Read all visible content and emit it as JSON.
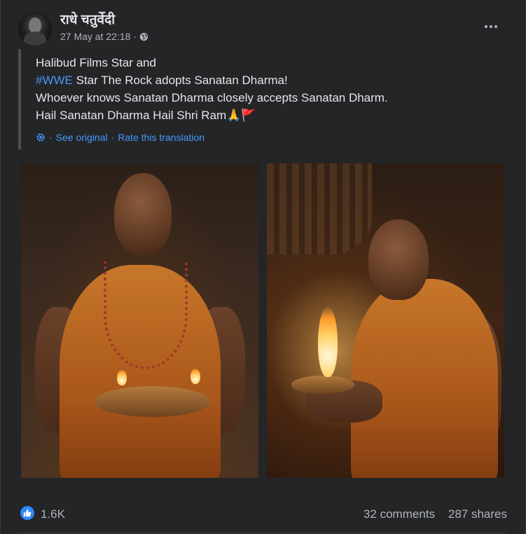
{
  "post": {
    "author": "राधे चतुर्वेदी",
    "timestamp": "27 May at 22:18",
    "separator": "·",
    "audience_icon": "globe-icon",
    "more_icon": "more-options-icon",
    "text_lines": [
      {
        "text": "Halibud Films Star and"
      },
      {
        "hashtag": "#WWE",
        "text": " Star The Rock adopts Sanatan Dharma!"
      },
      {
        "text": "Whoever knows Sanatan Dharma closely accepts Sanatan Dharm."
      },
      {
        "text": "Hail Sanatan Dharma Hail Shri Ram🙏🚩"
      }
    ],
    "translation": {
      "icon": "gear-icon",
      "see_original": "See original",
      "dot": "·",
      "rate": "Rate this translation"
    },
    "photos": [
      {
        "subject": "man in saffron robe holding tray of lit diyas"
      },
      {
        "subject": "man in saffron robe holding a single lit diya"
      }
    ]
  },
  "footer": {
    "reaction_icon": "like-icon",
    "reaction_count": "1.6K",
    "comments": "32 comments",
    "shares": "287 shares"
  },
  "colors": {
    "background": "#242526",
    "text": "#e4e6eb",
    "secondary_text": "#b0b3b8",
    "link": "#4599ff",
    "like_blue": "#2d88ff"
  }
}
